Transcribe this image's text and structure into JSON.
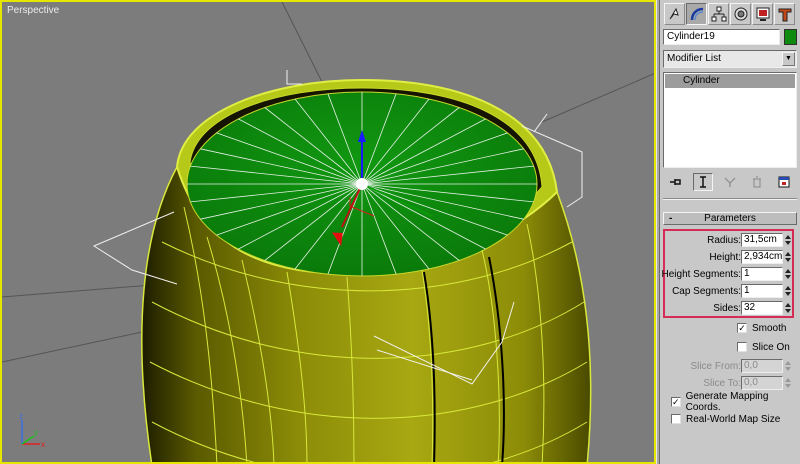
{
  "viewport": {
    "label": "Perspective",
    "axis_labels": {
      "x": "x",
      "y": "y",
      "z": "z"
    }
  },
  "panel": {
    "tabs": [
      {
        "name": "create-tab-icon",
        "active": false
      },
      {
        "name": "modify-tab-icon",
        "active": true
      },
      {
        "name": "hierarchy-tab-icon",
        "active": false
      },
      {
        "name": "motion-tab-icon",
        "active": false
      },
      {
        "name": "display-tab-icon",
        "active": false
      },
      {
        "name": "utilities-tab-icon",
        "active": false
      }
    ],
    "object_name": "Cylinder19",
    "object_color": "#0e8a0e",
    "modifier_list": "Modifier List",
    "stack_item": "Cylinder",
    "rollout_toggle": "-",
    "rollout_title": "Parameters",
    "params": {
      "radius_label": "Radius:",
      "radius": "31,5cm",
      "height_label": "Height:",
      "height": "2,934cm",
      "height_segments_label": "Height Segments:",
      "height_segments": "1",
      "cap_segments_label": "Cap Segments:",
      "cap_segments": "1",
      "sides_label": "Sides:",
      "sides": "32"
    },
    "smooth_label": "Smooth",
    "smooth_checked": "✓",
    "slice_on_label": "Slice On",
    "slice_on_checked": "",
    "slice_from_label": "Slice From:",
    "slice_from": "0,0",
    "slice_to_label": "Slice To:",
    "slice_to": "0,0",
    "gen_mapping_label": "Generate Mapping Coords.",
    "gen_mapping_checked": "✓",
    "real_world_label": "Real-World Map Size",
    "real_world_checked": "",
    "highlight_color": "#d62b55"
  }
}
